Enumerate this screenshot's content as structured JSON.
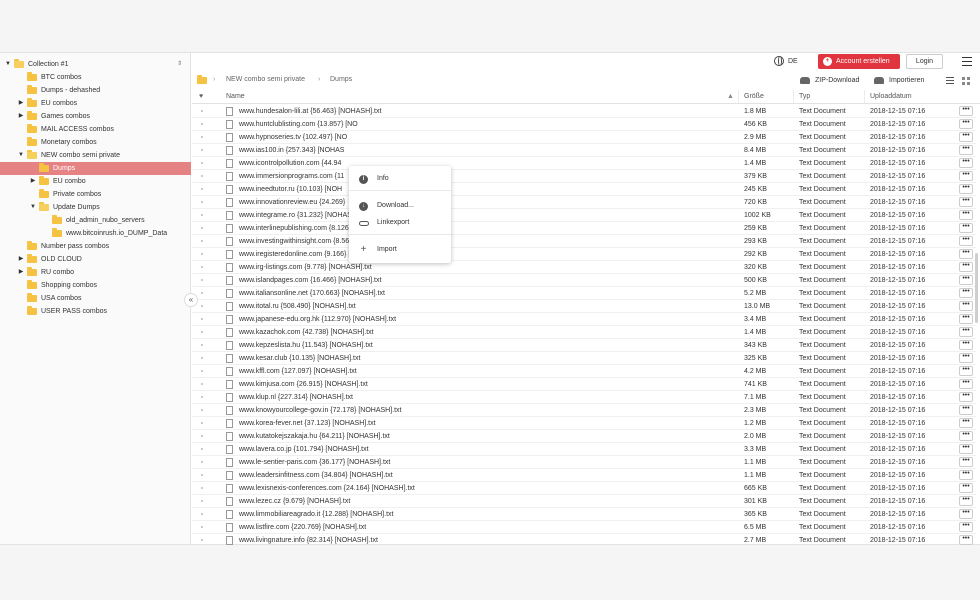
{
  "sidebar": {
    "tree": [
      {
        "label": "Collection #1",
        "level": 0,
        "caret": "down",
        "sort": true
      },
      {
        "label": "BTC combos",
        "level": 1,
        "caret": "none"
      },
      {
        "label": "Dumps - dehashed",
        "level": 1,
        "caret": "none"
      },
      {
        "label": "EU combos",
        "level": 1,
        "caret": "right"
      },
      {
        "label": "Games combos",
        "level": 1,
        "caret": "right"
      },
      {
        "label": "MAIL ACCESS combos",
        "level": 1,
        "caret": "none"
      },
      {
        "label": "Monetary combos",
        "level": 1,
        "caret": "none"
      },
      {
        "label": "NEW combo semi private",
        "level": 1,
        "caret": "down"
      },
      {
        "label": "Dumps",
        "level": 2,
        "caret": "none",
        "selected": true
      },
      {
        "label": "EU combo",
        "level": 2,
        "caret": "right"
      },
      {
        "label": "Private combos",
        "level": 2,
        "caret": "none"
      },
      {
        "label": "Update Dumps",
        "level": 2,
        "caret": "down"
      },
      {
        "label": "old_admin_nubo_servers",
        "level": 3,
        "caret": "none"
      },
      {
        "label": "www.bitcoinrush.io_DUMP_Data",
        "level": 3,
        "caret": "none"
      },
      {
        "label": "Number pass combos",
        "level": 1,
        "caret": "none"
      },
      {
        "label": "OLD CLOUD",
        "level": 1,
        "caret": "right"
      },
      {
        "label": "RU combo",
        "level": 1,
        "caret": "right"
      },
      {
        "label": "Shopping combos",
        "level": 1,
        "caret": "none"
      },
      {
        "label": "USA combos",
        "level": 1,
        "caret": "none"
      },
      {
        "label": "USER PASS combos",
        "level": 1,
        "caret": "none"
      }
    ],
    "collapse_label": "«"
  },
  "header": {
    "language": "DE",
    "account_label": "Account erstellen",
    "login_label": "Login"
  },
  "breadcrumb": {
    "items": [
      "NEW combo semi private",
      "Dumps"
    ]
  },
  "toolbar": {
    "zip_label": "ZIP-Download",
    "import_label": "Importieren"
  },
  "table": {
    "columns": {
      "name": "Name",
      "size": "Größe",
      "type": "Typ",
      "date": "Uploaddatum"
    },
    "rows": [
      {
        "name": "www.hundesalon-lili.at {56.463} [NOHASH].txt",
        "size": "1.8 MB",
        "type": "Text Document",
        "date": "2018-12-15 07:16"
      },
      {
        "name": "www.huntclublisting.com {13.857} [NO",
        "size": "456 KB",
        "type": "Text Document",
        "date": "2018-12-15 07:16"
      },
      {
        "name": "www.hypnoseries.tv {102.497} [NO",
        "size": "2.9 MB",
        "type": "Text Document",
        "date": "2018-12-15 07:16"
      },
      {
        "name": "www.ias100.in {257.343} [NOHAS",
        "size": "8.4 MB",
        "type": "Text Document",
        "date": "2018-12-15 07:16"
      },
      {
        "name": "www.icontrolpollution.com {44.94",
        "size": "1.4 MB",
        "type": "Text Document",
        "date": "2018-12-15 07:16"
      },
      {
        "name": "www.immersionprograms.com {11",
        "size": "379 KB",
        "type": "Text Document",
        "date": "2018-12-15 07:16"
      },
      {
        "name": "www.ineedtutor.ru {10.103} [NOH",
        "size": "245 KB",
        "type": "Text Document",
        "date": "2018-12-15 07:16"
      },
      {
        "name": "www.innovationreview.eu {24.269}",
        "size": "720 KB",
        "type": "Text Document",
        "date": "2018-12-15 07:16"
      },
      {
        "name": "www.integrame.ro {31.232} [NOHASH].txt",
        "size": "1002 KB",
        "type": "Text Document",
        "date": "2018-12-15 07:16"
      },
      {
        "name": "www.interlinepublishing.com {8.126} [NOHASH].txt",
        "size": "259 KB",
        "type": "Text Document",
        "date": "2018-12-15 07:16"
      },
      {
        "name": "www.investingwithinsight.com {8.560} [NOHASH].txt",
        "size": "293 KB",
        "type": "Text Document",
        "date": "2018-12-15 07:16"
      },
      {
        "name": "www.iregisteredonline.com {9.166} [NOHASH].txt",
        "size": "292 KB",
        "type": "Text Document",
        "date": "2018-12-15 07:16"
      },
      {
        "name": "www.irg-listings.com {9.778} [NOHASH].txt",
        "size": "320 KB",
        "type": "Text Document",
        "date": "2018-12-15 07:16"
      },
      {
        "name": "www.islandpages.com {16.466} [NOHASH].txt",
        "size": "500 KB",
        "type": "Text Document",
        "date": "2018-12-15 07:16"
      },
      {
        "name": "www.italiansonline.net {170.663} [NOHASH].txt",
        "size": "5.2 MB",
        "type": "Text Document",
        "date": "2018-12-15 07:16"
      },
      {
        "name": "www.itotal.ru {508.490} [NOHASH].txt",
        "size": "13.0 MB",
        "type": "Text Document",
        "date": "2018-12-15 07:16"
      },
      {
        "name": "www.japanese-edu.org.hk {112.970} [NOHASH].txt",
        "size": "3.4 MB",
        "type": "Text Document",
        "date": "2018-12-15 07:16"
      },
      {
        "name": "www.kazachok.com {42.738} [NOHASH].txt",
        "size": "1.4 MB",
        "type": "Text Document",
        "date": "2018-12-15 07:16"
      },
      {
        "name": "www.kepzeslista.hu {11.543} [NOHASH].txt",
        "size": "343 KB",
        "type": "Text Document",
        "date": "2018-12-15 07:16"
      },
      {
        "name": "www.kesar.club {10.135} [NOHASH].txt",
        "size": "325 KB",
        "type": "Text Document",
        "date": "2018-12-15 07:16"
      },
      {
        "name": "www.kffl.com {127.097} [NOHASH].txt",
        "size": "4.2 MB",
        "type": "Text Document",
        "date": "2018-12-15 07:16"
      },
      {
        "name": "www.kimjusa.com {26.915} [NOHASH].txt",
        "size": "741 KB",
        "type": "Text Document",
        "date": "2018-12-15 07:16"
      },
      {
        "name": "www.klup.nl {227.314} [NOHASH].txt",
        "size": "7.1 MB",
        "type": "Text Document",
        "date": "2018-12-15 07:16"
      },
      {
        "name": "www.knowyourcollege-gov.in {72.178} [NOHASH].txt",
        "size": "2.3 MB",
        "type": "Text Document",
        "date": "2018-12-15 07:16"
      },
      {
        "name": "www.korea-fever.net {37.123} [NOHASH].txt",
        "size": "1.2 MB",
        "type": "Text Document",
        "date": "2018-12-15 07:16"
      },
      {
        "name": "www.kutatokejszakaja.hu {64.211} [NOHASH].txt",
        "size": "2.0 MB",
        "type": "Text Document",
        "date": "2018-12-15 07:16"
      },
      {
        "name": "www.lavera.co.jp {101.794} [NOHASH].txt",
        "size": "3.3 MB",
        "type": "Text Document",
        "date": "2018-12-15 07:16"
      },
      {
        "name": "www.le-sentier-paris.com {36.177} [NOHASH].txt",
        "size": "1.1 MB",
        "type": "Text Document",
        "date": "2018-12-15 07:16"
      },
      {
        "name": "www.leadersinfitness.com {34.804} [NOHASH].txt",
        "size": "1.1 MB",
        "type": "Text Document",
        "date": "2018-12-15 07:16"
      },
      {
        "name": "www.lexisnexis-conferences.com {24.164} [NOHASH].txt",
        "size": "665 KB",
        "type": "Text Document",
        "date": "2018-12-15 07:16"
      },
      {
        "name": "www.lezec.cz {9.679} [NOHASH].txt",
        "size": "301 KB",
        "type": "Text Document",
        "date": "2018-12-15 07:16"
      },
      {
        "name": "www.limmobiliareagrado.it {12.288} [NOHASH].txt",
        "size": "365 KB",
        "type": "Text Document",
        "date": "2018-12-15 07:16"
      },
      {
        "name": "www.listfire.com {220.769} [NOHASH].txt",
        "size": "6.5 MB",
        "type": "Text Document",
        "date": "2018-12-15 07:16"
      },
      {
        "name": "www.livingnature.info {82.314} [NOHASH].txt",
        "size": "2.7 MB",
        "type": "Text Document",
        "date": "2018-12-15 07:16"
      }
    ],
    "more_label": "•••"
  },
  "context_menu": {
    "items": [
      {
        "label": "Info",
        "icon": "info-icon"
      },
      {
        "label": "Download...",
        "icon": "download-icon"
      },
      {
        "label": "Linkexport",
        "icon": "link-icon"
      },
      {
        "label": "Import",
        "icon": "plus-icon"
      }
    ]
  },
  "colors": {
    "accent": "#e0353f",
    "selected": "#e58384",
    "folder": "#f5c242"
  }
}
